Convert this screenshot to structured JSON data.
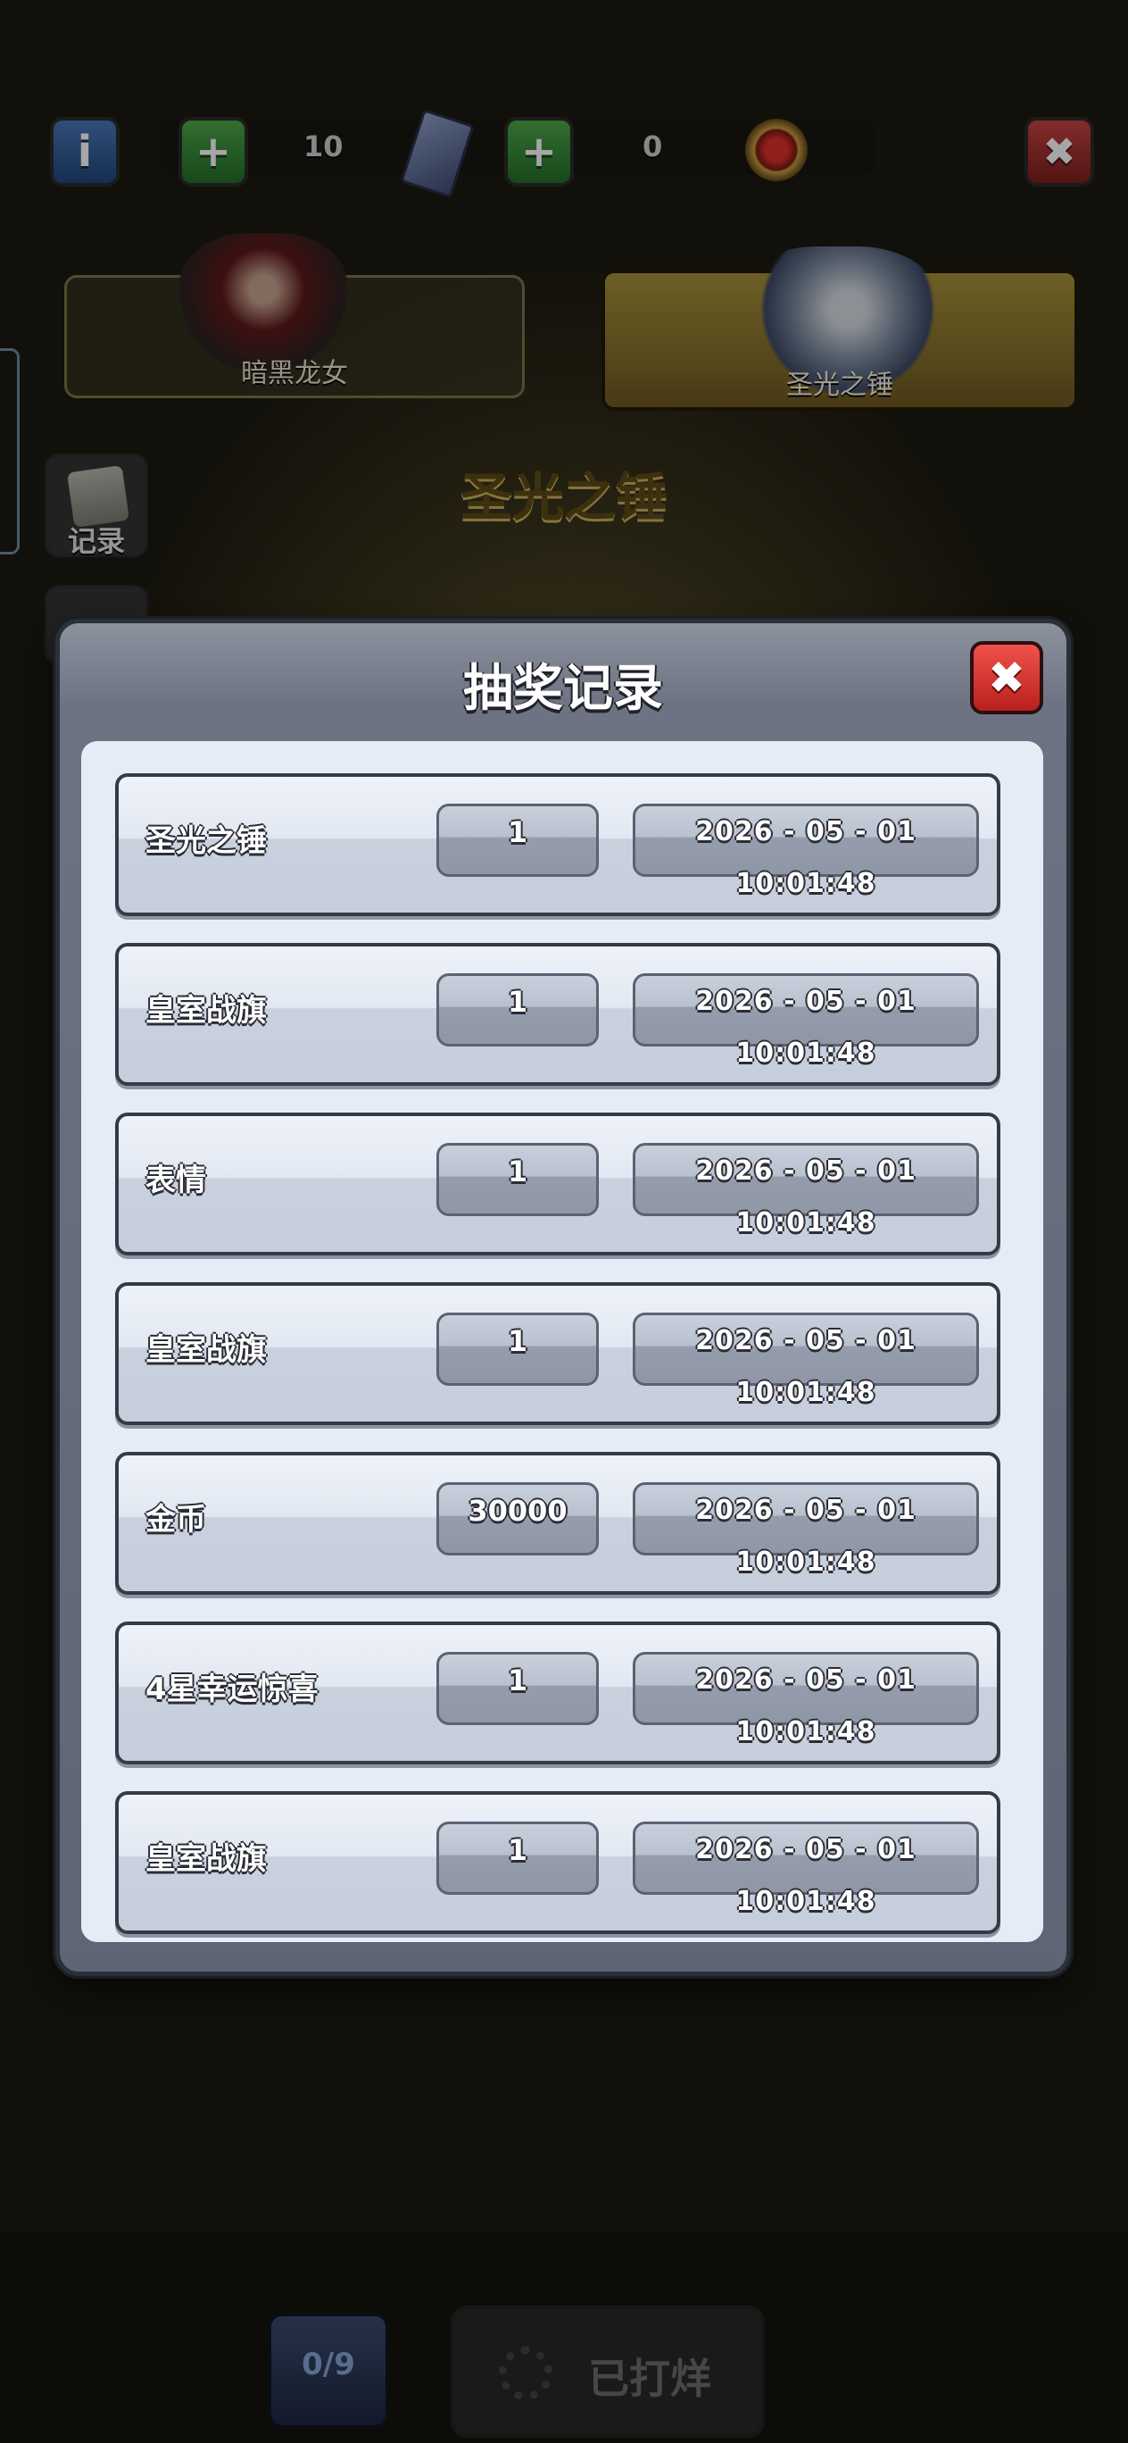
{
  "topbar": {
    "info_label": "i",
    "plus_label": "+",
    "ticket_count": "10",
    "token_count": "0",
    "close_label": "✖"
  },
  "heroes": {
    "left_name": "暗黑龙女",
    "right_name": "圣光之锤",
    "selected_title": "圣光之锤"
  },
  "side": {
    "record_label": "记录"
  },
  "bottom": {
    "counter": "0/9",
    "button_label": "已打烊"
  },
  "modal": {
    "title": "抽奖记录",
    "close_label": "✖",
    "records": [
      {
        "name": "圣光之锤",
        "qty": "1",
        "time": "2026 - 05 - 01  10:01:48"
      },
      {
        "name": "皇室战旗",
        "qty": "1",
        "time": "2026 - 05 - 01  10:01:48"
      },
      {
        "name": "表情",
        "qty": "1",
        "time": "2026 - 05 - 01  10:01:48"
      },
      {
        "name": "皇室战旗",
        "qty": "1",
        "time": "2026 - 05 - 01  10:01:48"
      },
      {
        "name": "金币",
        "qty": "30000",
        "time": "2026 - 05 - 01  10:01:48"
      },
      {
        "name": "4星幸运惊喜",
        "qty": "1",
        "time": "2026 - 05 - 01  10:01:48"
      },
      {
        "name": "皇室战旗",
        "qty": "1",
        "time": "2026 - 05 - 01  10:01:48"
      }
    ]
  }
}
